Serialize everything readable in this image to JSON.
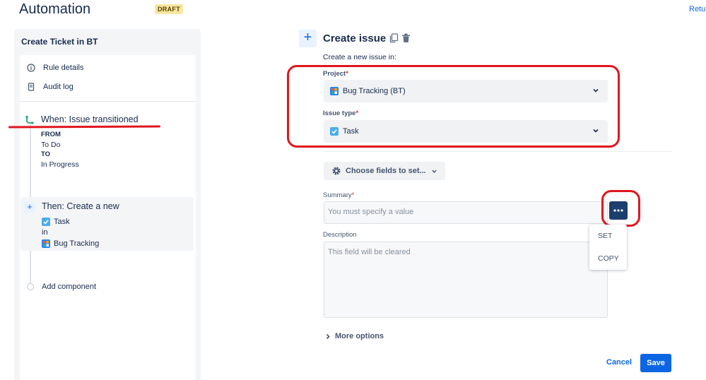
{
  "header": {
    "title": "Automation",
    "badge": "DRAFT",
    "return_link": "Retu"
  },
  "sidebar": {
    "rule_name": "Create Ticket in BT",
    "menu": [
      {
        "label": "Rule details",
        "icon": "info-icon"
      },
      {
        "label": "Audit log",
        "icon": "document-icon"
      }
    ],
    "trigger": {
      "title": "When: Issue transitioned",
      "from_label": "FROM",
      "from_value": "To Do",
      "to_label": "TO",
      "to_value": "In Progress"
    },
    "action": {
      "title": "Then: Create a new",
      "issue_type": "Task",
      "in_label": "in",
      "project": "Bug Tracking"
    },
    "add_component": "Add component"
  },
  "form": {
    "title": "Create issue",
    "subtitle": "Create a new issue in:",
    "project_label": "Project",
    "project_value": "Bug Tracking (BT)",
    "issue_type_label": "Issue type",
    "issue_type_value": "Task",
    "choose_fields": "Choose fields to set...",
    "summary_label": "Summary",
    "summary_placeholder": "You must specify a value",
    "description_label": "Description",
    "description_placeholder": "This field will be cleared",
    "more_options": "More options",
    "required_mark": "*"
  },
  "dropdown": {
    "items": [
      "SET",
      "COPY"
    ]
  },
  "footer": {
    "cancel": "Cancel",
    "save": "Save"
  },
  "colors": {
    "accent": "#0c66e4",
    "annotation_red": "#e0161e",
    "badge_bg": "#f8e6a0"
  }
}
